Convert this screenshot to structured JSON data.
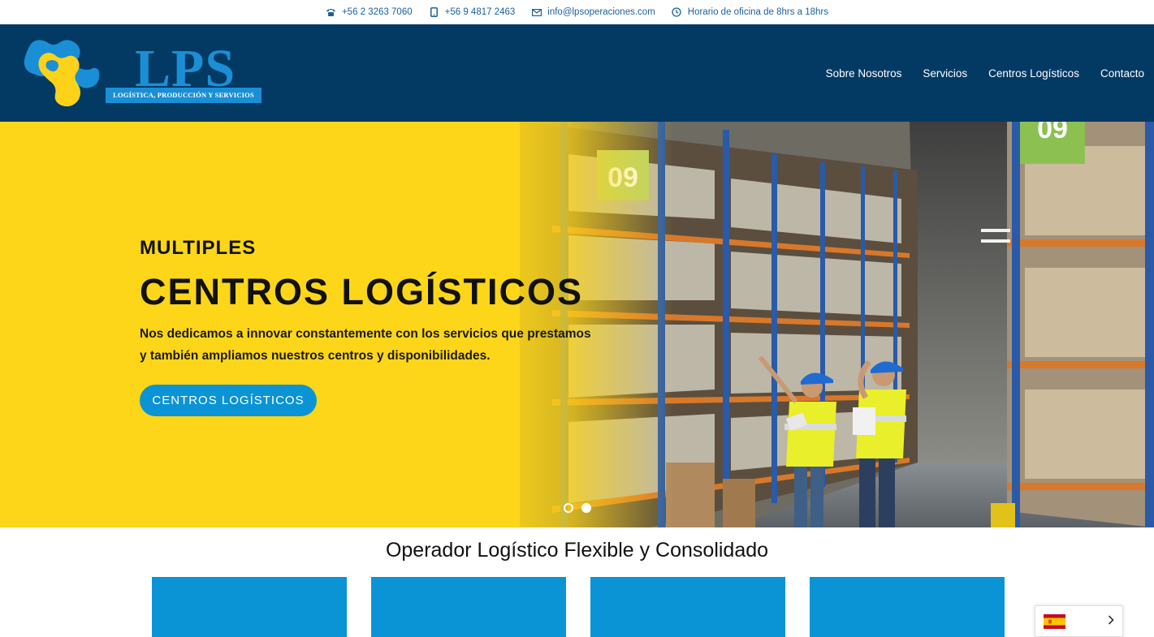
{
  "topbar": {
    "phone": "+56 2 3263 7060",
    "mobile": "+56 9 4817 2463",
    "email": "info@lpsoperaciones.com",
    "hours": "Horario de oficina de 8hrs a 18hrs",
    "icons": [
      "phone-icon",
      "mobile-icon",
      "mail-icon",
      "clock-icon"
    ]
  },
  "logo": {
    "name": "LPS",
    "tagline": "LOGÍSTICA, PRODUCCIÓN Y SERVICIOS"
  },
  "nav": {
    "items": [
      "Sobre Nosotros",
      "Servicios",
      "Centros Logísticos",
      "Contacto"
    ]
  },
  "hero": {
    "subtitle": "MULTIPLES",
    "title": "CENTROS LOGÍSTICOS",
    "text": "Nos dedicamos a innovar constantemente con los servicios que prestamos y también ampliamos nuestros centros y disponibilidades.",
    "button": "CENTROS LOGÍSTICOS",
    "slides": 2,
    "active_slide": 2,
    "shelf_labels": [
      "09",
      "09"
    ]
  },
  "section": {
    "title": "Operador Logístico Flexible y Consolidado",
    "cards": 4
  },
  "language": {
    "current": "Español",
    "flag": "spain-flag-icon"
  },
  "colors": {
    "header": "#033a64",
    "accent": "#0a94d6",
    "hero_yellow": "#fdd619",
    "topbar_text": "#1a5f9c"
  }
}
